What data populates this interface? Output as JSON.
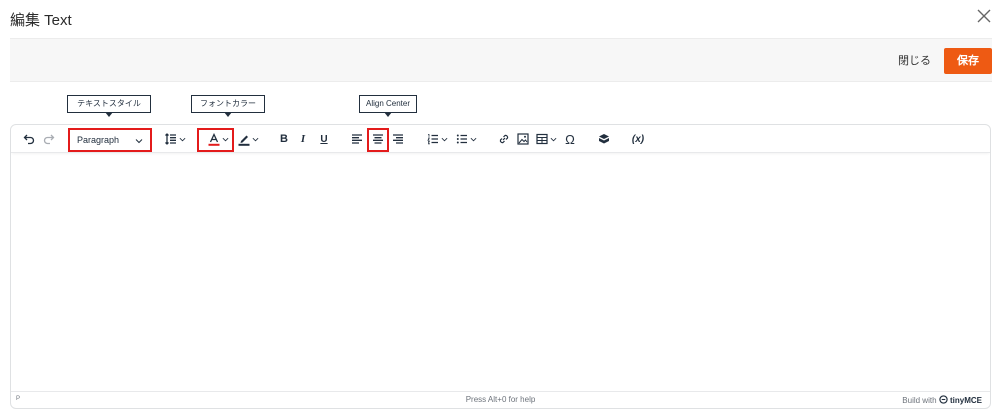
{
  "dialog": {
    "title": "編集 Text",
    "close_icon": "close-icon"
  },
  "actions": {
    "close_label": "閉じる",
    "save_label": "保存",
    "accent_color": "#ee5a13"
  },
  "tooltips": {
    "text_style": "テキストスタイル",
    "font_color": "フォントカラー",
    "align_center": "Align Center"
  },
  "toolbar": {
    "block_format_value": "Paragraph",
    "buttons": [
      "undo-icon",
      "redo-icon",
      "line-height-icon",
      "text-color-icon",
      "highlight-icon",
      "bold-icon",
      "italic-icon",
      "underline-icon",
      "align-left-icon",
      "align-center-icon",
      "align-right-icon",
      "numbered-list-icon",
      "bullet-list-icon",
      "link-icon",
      "image-icon",
      "table-icon",
      "special-char-icon",
      "template-icon",
      "variable-icon"
    ],
    "bold_label": "B",
    "italic_label": "I",
    "underline_label": "U",
    "omega_label": "Ω",
    "variable_label": "(x)",
    "highlight_color": "#e31b1b"
  },
  "statusbar": {
    "path": "P",
    "help": "Press Alt+0 for help",
    "build_with": "Build with",
    "brand": "tinyMCE"
  }
}
